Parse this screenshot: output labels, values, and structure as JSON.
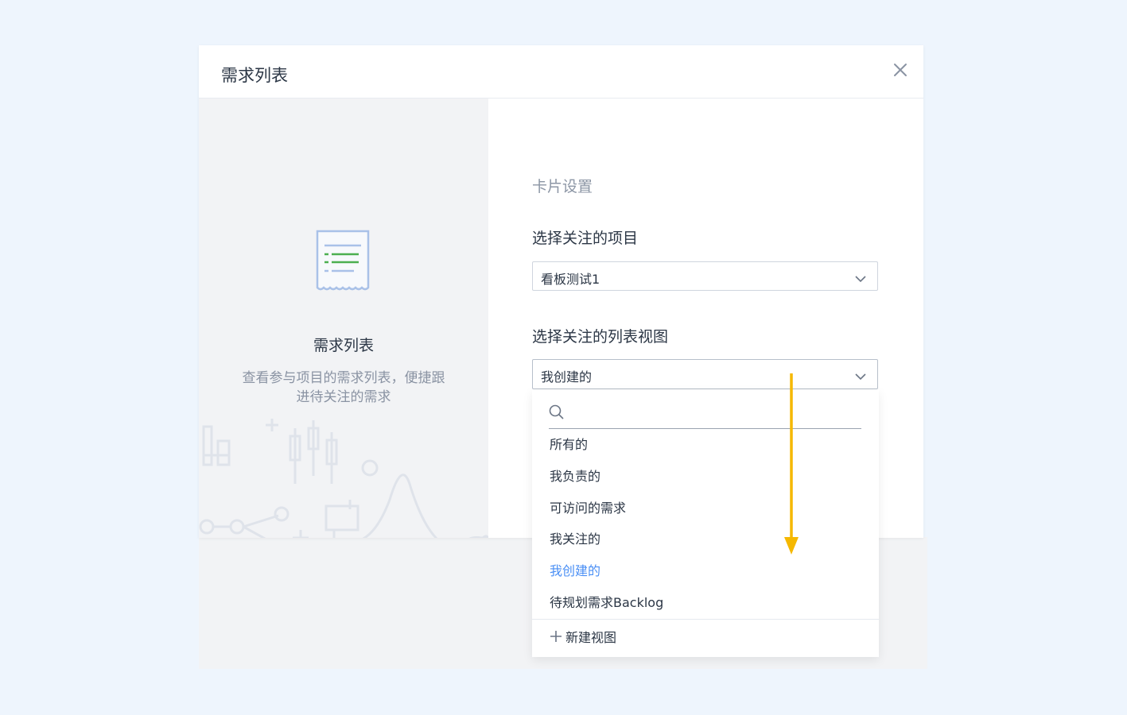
{
  "dialog": {
    "title": "需求列表",
    "close_icon": "close-icon"
  },
  "preview": {
    "icon": "document-list-icon",
    "title": "需求列表",
    "description": "查看参与项目的需求列表，便捷跟进待关注的需求"
  },
  "settings": {
    "section_title": "卡片设置",
    "project_label": "选择关注的项目",
    "project_value": "看板测试1",
    "view_label": "选择关注的列表视图",
    "view_value": "我创建的"
  },
  "dropdown": {
    "search_placeholder": "",
    "items": [
      {
        "label": "所有的"
      },
      {
        "label": "我负责的"
      },
      {
        "label": "可访问的需求"
      },
      {
        "label": "我关注的"
      },
      {
        "label": "我创建的",
        "selected": true
      },
      {
        "label": "待规划需求Backlog"
      }
    ],
    "new_view_label": "新建视图"
  },
  "colors": {
    "accent": "#4a8ff5",
    "highlight_border": "#f5b800",
    "page_bg": "#eef5fd"
  }
}
